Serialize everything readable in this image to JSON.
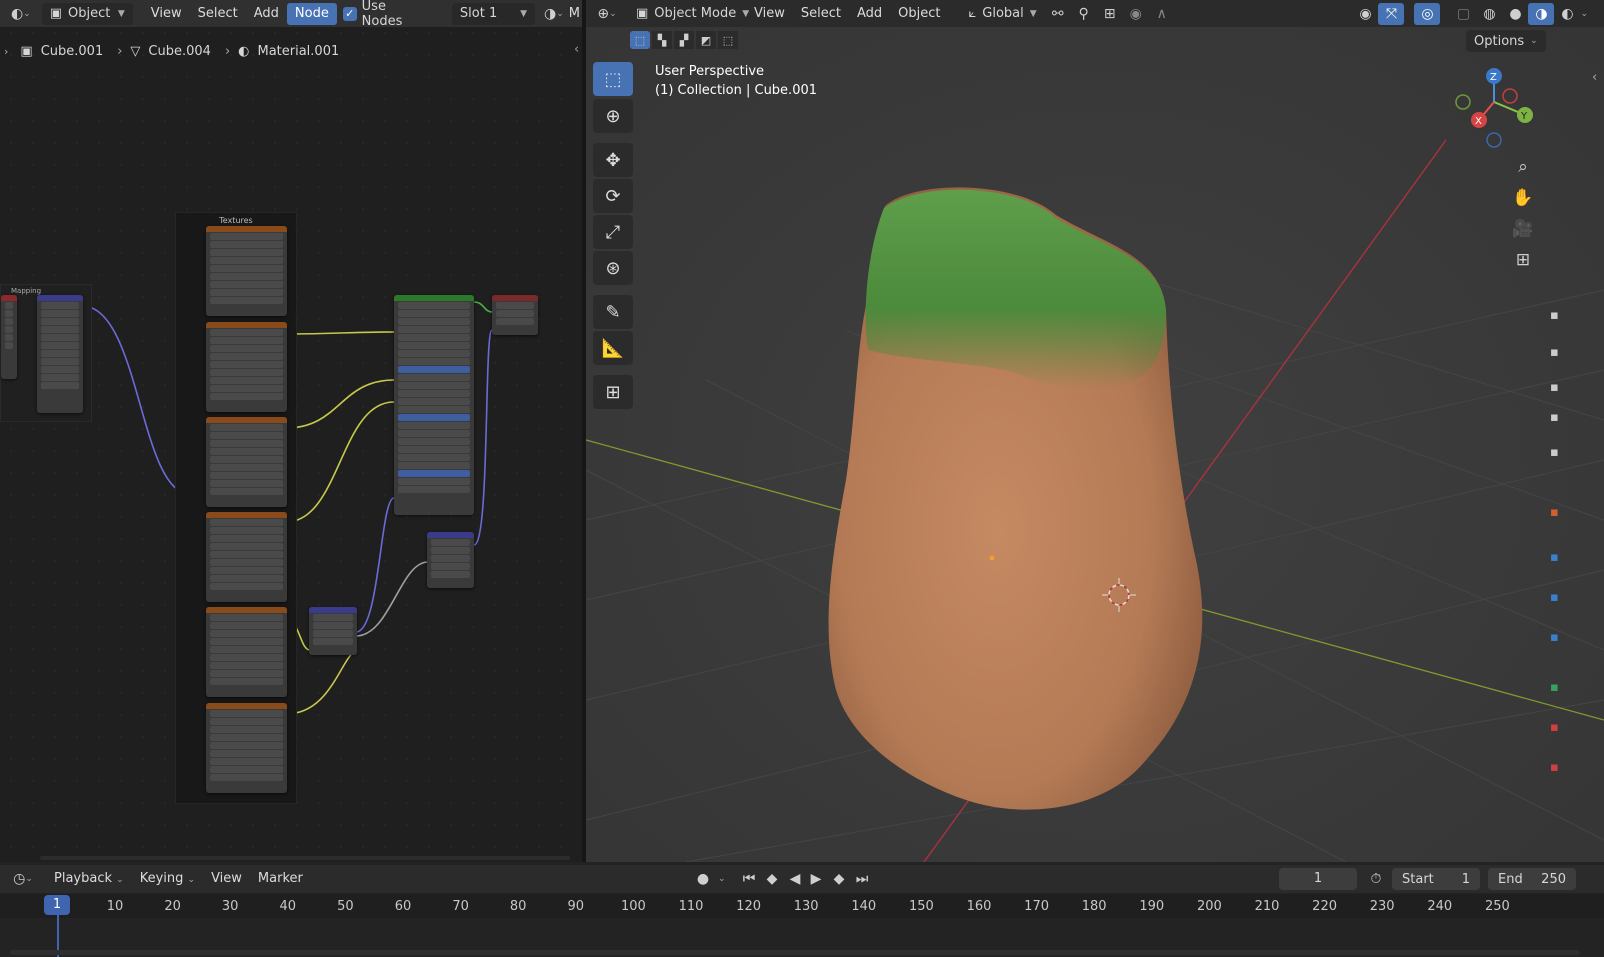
{
  "node_editor_header": {
    "editor_type_icon": "node-editor-icon",
    "object_dropdown": "Object",
    "menus": [
      "View",
      "Select",
      "Add",
      "Node"
    ],
    "use_nodes_label": "Use Nodes",
    "use_nodes_checked": true,
    "slot_dropdown": "Slot 1",
    "partial_label": "M"
  },
  "breadcrumb": {
    "items": [
      {
        "icon": "mesh-object-icon",
        "label": "Cube.001"
      },
      {
        "icon": "mesh-data-icon",
        "label": "Cube.004"
      },
      {
        "icon": "material-icon",
        "label": "Material.001"
      }
    ]
  },
  "node_graph": {
    "frame_label": "Textures",
    "mapping_frame_label": "Mapping",
    "colors": {
      "wire_purple": "#6b6bd8",
      "wire_yellow": "#c8c84a",
      "wire_grey": "#a0a0a0",
      "tex_header": "#8a4a1c",
      "shader_header": "#2a7a2a",
      "vector_header": "#3b3b8c",
      "output_header": "#7a2a2a"
    }
  },
  "viewport_header": {
    "mode_dropdown": "Object Mode",
    "menus": [
      "View",
      "Select",
      "Add",
      "Object"
    ],
    "orientation_dropdown": "Global",
    "options_label": "Options"
  },
  "viewport": {
    "view_name": "User Perspective",
    "collection_info": "(1) Collection | Cube.001",
    "gizmo": {
      "z": "Z",
      "y": "Y",
      "x": "X"
    },
    "tools": [
      "select-box-icon",
      "cursor-icon",
      "move-icon",
      "rotate-icon",
      "scale-icon",
      "transform-icon",
      "annotate-icon",
      "measure-icon",
      "add-cube-icon"
    ],
    "nav_icons": [
      "zoom-icon",
      "pan-hand-icon",
      "camera-icon",
      "ortho-grid-icon"
    ]
  },
  "timeline_header": {
    "menus": [
      "Playback",
      "Keying",
      "View",
      "Marker"
    ],
    "current_frame": "1",
    "start_label": "Start",
    "start_value": "1",
    "end_label": "End",
    "end_value": "250"
  },
  "timeline": {
    "current": "1",
    "ticks": [
      "10",
      "20",
      "30",
      "40",
      "50",
      "60",
      "70",
      "80",
      "90",
      "100",
      "110",
      "120",
      "130",
      "140",
      "150",
      "160",
      "170",
      "180",
      "190",
      "200",
      "210",
      "220",
      "230",
      "240",
      "250"
    ]
  }
}
